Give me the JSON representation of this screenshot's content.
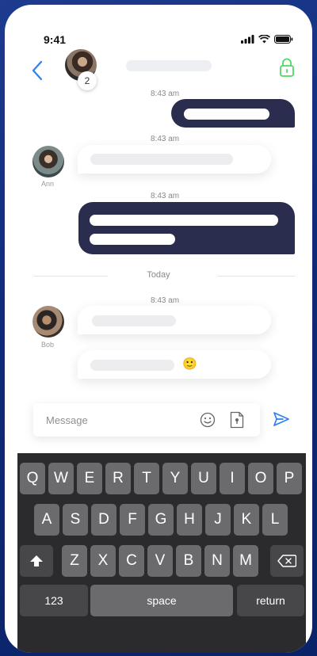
{
  "status_bar": {
    "time": "9:41"
  },
  "header": {
    "member_count": "2"
  },
  "chat": {
    "timestamps": [
      "8:43 am",
      "8:43 am",
      "8:43 am",
      "8:43 am"
    ],
    "day_separator": "Today",
    "senders": [
      "Ann",
      "Bob"
    ],
    "emoji": "🙂"
  },
  "composer": {
    "placeholder": "Message"
  },
  "keyboard": {
    "row1": [
      "Q",
      "W",
      "E",
      "R",
      "T",
      "Y",
      "U",
      "I",
      "O",
      "P"
    ],
    "row2": [
      "A",
      "S",
      "D",
      "F",
      "G",
      "H",
      "J",
      "K",
      "L"
    ],
    "row3": [
      "Z",
      "X",
      "C",
      "V",
      "B",
      "N",
      "M"
    ],
    "numbers": "123",
    "space": "space",
    "return": "return"
  },
  "colors": {
    "accent": "#2f80ed",
    "lock": "#4cd964",
    "bubble_out": "#2b2d4e",
    "keyboard_bg": "#2b2b2d"
  }
}
